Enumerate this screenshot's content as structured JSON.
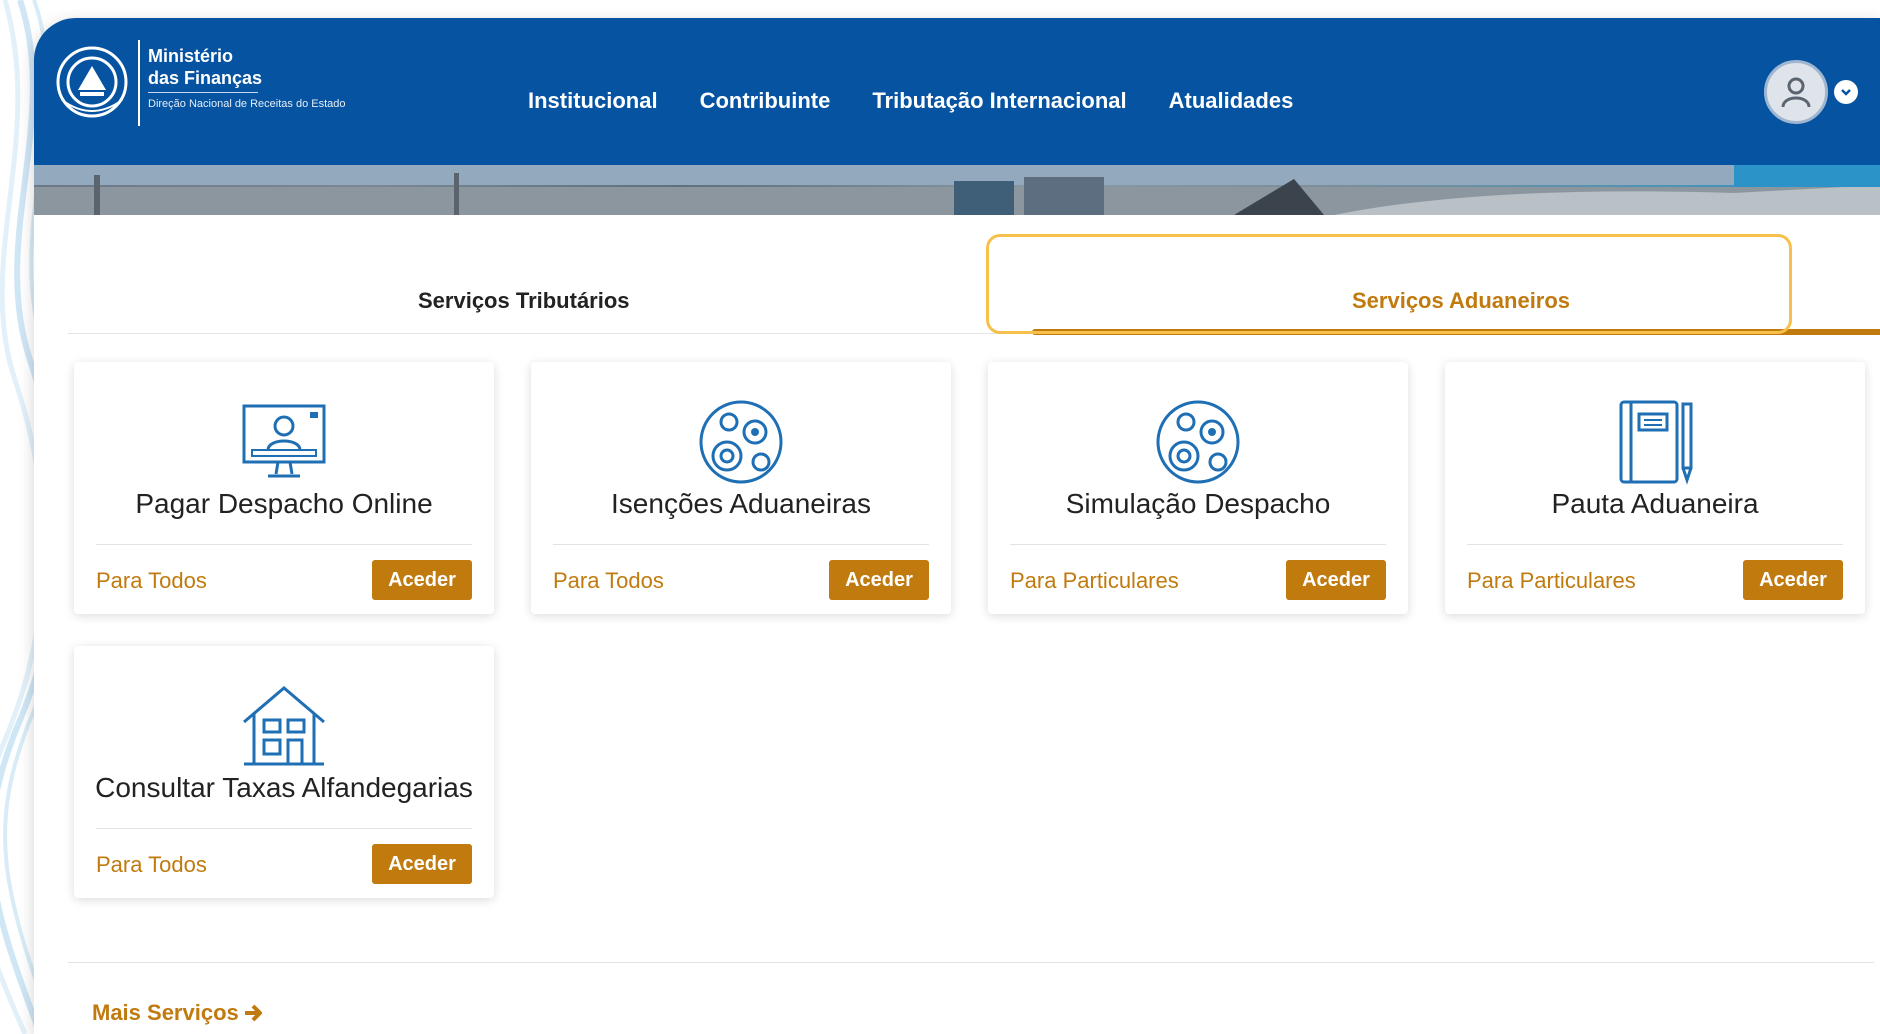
{
  "brand": {
    "line1": "Ministério",
    "line2": "das Finanças",
    "line3": "Direção Nacional de Receitas do Estado"
  },
  "nav": [
    {
      "label": "Institucional"
    },
    {
      "label": "Contribuinte"
    },
    {
      "label": "Tributação Internacional"
    },
    {
      "label": "Atualidades"
    }
  ],
  "tabs": [
    {
      "label": "Serviços Tributários",
      "active": false
    },
    {
      "label": "Serviços Aduaneiros",
      "active": true
    }
  ],
  "cards": [
    {
      "title": "Pagar Despacho Online",
      "audience": "Para Todos",
      "button": "Aceder",
      "icon": "monitor-user-icon"
    },
    {
      "title": "Isenções Aduaneiras",
      "audience": "Para Todos",
      "button": "Aceder",
      "icon": "gears-icon"
    },
    {
      "title": "Simulação Despacho",
      "audience": "Para Particulares",
      "button": "Aceder",
      "icon": "gears-icon"
    },
    {
      "title": "Pauta Aduaneira",
      "audience": "Para Particulares",
      "button": "Aceder",
      "icon": "notebook-pencil-icon"
    },
    {
      "title": "Consultar Taxas Alfandegarias",
      "audience": "Para Todos",
      "button": "Aceder",
      "icon": "house-icon"
    }
  ],
  "more_services": {
    "label": "Mais Serviços"
  },
  "colors": {
    "header": "#0553a1",
    "accent": "#c07a0e",
    "highlight": "#f7c04a",
    "icon": "#1f6fb5"
  }
}
